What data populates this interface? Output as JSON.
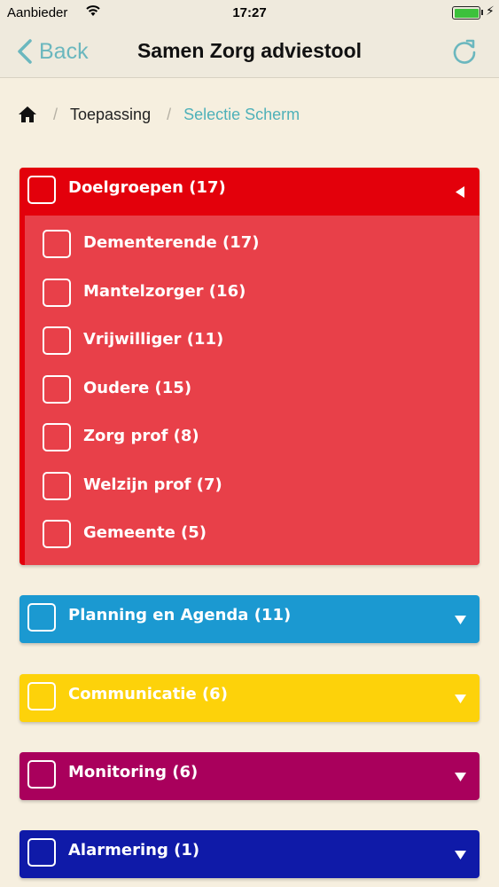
{
  "status_bar": {
    "carrier": "Aanbieder",
    "time": "17:27",
    "battery_level": 1.0
  },
  "nav": {
    "back_label": "Back",
    "title": "Samen Zorg adviestool",
    "accent_color": "#6bb7be"
  },
  "breadcrumb": {
    "items": [
      "Toepassing",
      "Selectie Scherm"
    ]
  },
  "categories": [
    {
      "label": "Doelgroepen (17)",
      "color": "#e3000b",
      "expanded": true,
      "items": [
        "Dementerende (17)",
        "Mantelzorger (16)",
        "Vrijwilliger (11)",
        "Oudere (15)",
        "Zorg prof (8)",
        "Welzijn prof (7)",
        "Gemeente (5)"
      ]
    },
    {
      "label": "Planning en Agenda (11)",
      "color": "#1b99d1",
      "expanded": false
    },
    {
      "label": "Communicatie (6)",
      "color": "#fdd20a",
      "expanded": false
    },
    {
      "label": "Monitoring (6)",
      "color": "#a9005c",
      "expanded": false
    },
    {
      "label": "Alarmering (1)",
      "color": "#0f1aa8",
      "expanded": false
    }
  ]
}
